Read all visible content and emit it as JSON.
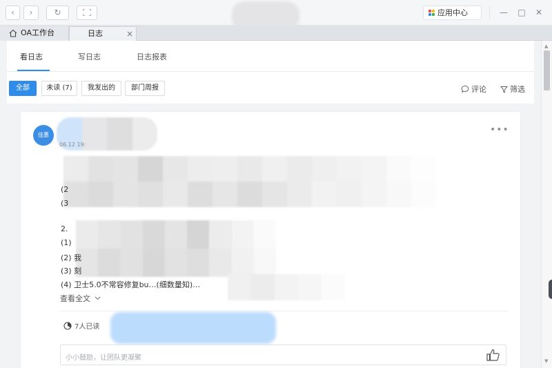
{
  "titlebar": {
    "app_center": "应用中心",
    "minimize": "—",
    "maximize": "□",
    "close": "✕"
  },
  "tabs": [
    {
      "label": "OA工作台"
    },
    {
      "label": "日志",
      "close": "×"
    }
  ],
  "subtabs": [
    "看日志",
    "写日志",
    "日志报表"
  ],
  "filters": {
    "buttons": [
      "全部",
      "未读 (7)",
      "我发出的",
      "部门周报"
    ],
    "comment_label": "评论",
    "filter_label": "筛选"
  },
  "card": {
    "avatar_text": "佳惠",
    "more": "•••",
    "date": "06.12 19:",
    "lines": [
      "(2",
      "(3",
      "",
      "2.",
      "(1)",
      "(2) 我",
      "(3) 刻",
      "(4) 卫士5.0不常容修复bu…(细数量知)…"
    ],
    "view_all": "查看全文",
    "read_count": "7人已读",
    "comment_placeholder": "小小鼓励，让团队更凝聚"
  },
  "colors": {
    "accent": "#2f8ce8",
    "avatar": "#3c8ee5"
  },
  "icons": [
    "chevron-left-icon",
    "chevron-right-icon",
    "refresh-icon",
    "fullscreen-icon",
    "home-icon",
    "comment-icon",
    "filter-icon",
    "pie-icon",
    "thumbs-up-icon"
  ]
}
